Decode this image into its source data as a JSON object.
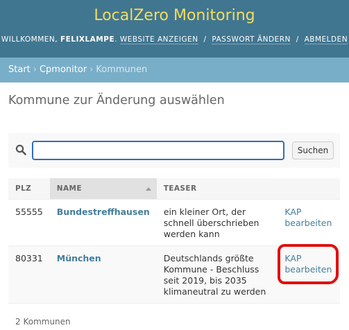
{
  "header": {
    "site_title": "LocalZero Monitoring",
    "welcome": "Willkommen,",
    "username": "felixlampe",
    "period": ".",
    "links": {
      "view_site": "Website anzeigen",
      "change_password": "Passwort ändern",
      "logout": "Abmelden"
    },
    "separator": "/"
  },
  "breadcrumb": {
    "items": [
      "Start",
      "Cpmonitor"
    ],
    "current": "Kommunen",
    "arrow": "›"
  },
  "page": {
    "title": "Kommune zur Änderung auswählen"
  },
  "search": {
    "value": "",
    "button_label": "Suchen"
  },
  "table": {
    "headers": {
      "plz": "PLZ",
      "name": "Name",
      "teaser": "Teaser"
    },
    "rows": [
      {
        "plz": "55555",
        "name": "Bundestreffhausen",
        "teaser": "ein kleiner Ort, der schnell überschrieben werden kann",
        "action_line1": "KAP",
        "action_line2": "bearbeiten"
      },
      {
        "plz": "80331",
        "name": "München",
        "teaser": "Deutschlands größte Kommune - Beschluss seit 2019, bis 2035 klimaneutral zu werden",
        "action_line1": "KAP",
        "action_line2": "bearbeiten"
      }
    ]
  },
  "paginator": {
    "text": "2 Kommunen"
  },
  "colors": {
    "header_bg": "#417690",
    "breadcrumb_bg": "#79aec8",
    "title_yellow": "#f5dd5d",
    "link_blue": "#447e9b",
    "annotation_red": "#e01010"
  }
}
